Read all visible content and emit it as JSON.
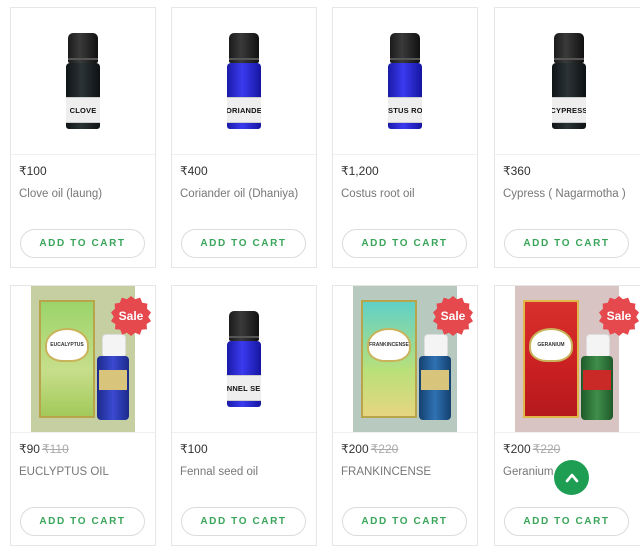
{
  "products": [
    {
      "price": "₹100",
      "name": "Clove oil (laung)",
      "label": "CLOVE",
      "button": "ADD TO CART"
    },
    {
      "price": "₹400",
      "name": "Coriander oil (Dhaniya)",
      "label": "CORIANDER",
      "button": "ADD TO CART"
    },
    {
      "price": "₹1,200",
      "name": "Costus root oil",
      "label": "COSTUS ROOT",
      "button": "ADD TO CART"
    },
    {
      "price": "₹360",
      "name": "Cypress ( Nagarmotha )",
      "label": "CYPRESS",
      "button": "ADD TO CART"
    },
    {
      "price": "₹90",
      "old_price": "₹110",
      "name": "EUCLYPTUS OIL",
      "label": "EUCALYPTUS",
      "sale": "Sale",
      "button": "ADD TO CART"
    },
    {
      "price": "₹100",
      "name": "Fennal seed oil",
      "label": "FENNEL SEED",
      "button": "ADD TO CART"
    },
    {
      "price": "₹200",
      "old_price": "₹220",
      "name": "FRANKINCENSE",
      "label": "FRANKINCENSE",
      "sale": "Sale",
      "button": "ADD TO CART"
    },
    {
      "price": "₹200",
      "old_price": "₹220",
      "name": "Geranium",
      "label": "GERANIUM",
      "sale": "Sale",
      "button": "ADD TO CART"
    }
  ],
  "colors": {
    "accent": "#3aa55a",
    "sale": "#e5484d",
    "scroll_button": "#1d9e52"
  },
  "scroll_top_icon": "chevron-up-icon"
}
